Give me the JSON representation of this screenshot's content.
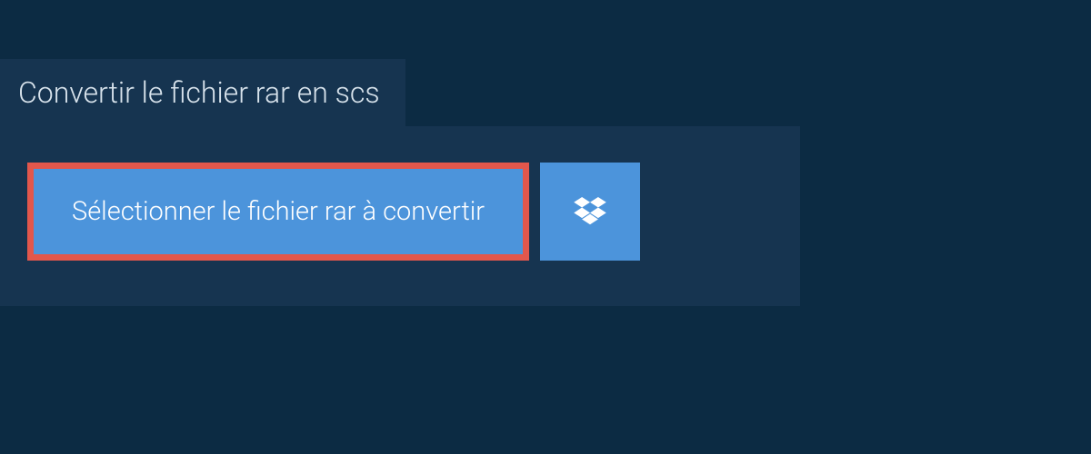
{
  "header": {
    "tab_label": "Convertir le fichier rar en scs"
  },
  "actions": {
    "select_file_label": "Sélectionner le fichier rar à convertir",
    "dropbox_icon_name": "dropbox-icon"
  },
  "colors": {
    "background": "#0c2b43",
    "panel": "#163450",
    "button": "#4c94db",
    "highlight_border": "#e2574c",
    "text_light": "#d8e3ec",
    "text_white": "#ffffff"
  }
}
